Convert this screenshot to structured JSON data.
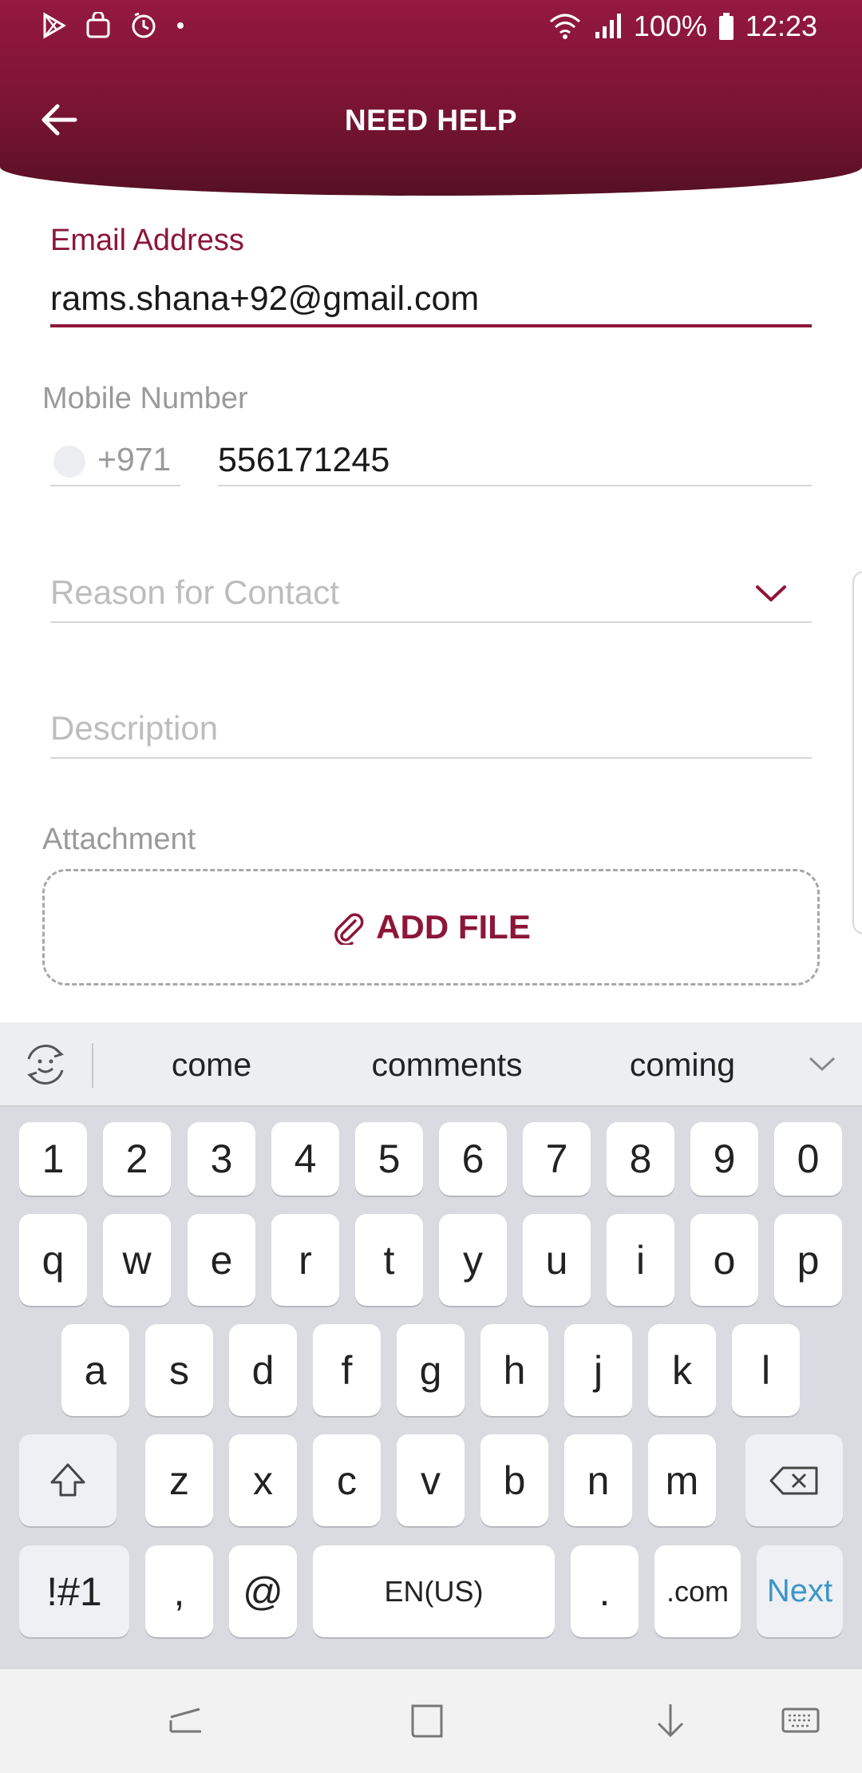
{
  "status_bar": {
    "battery": "100%",
    "time": "12:23",
    "left_icons": [
      "play-store-icon",
      "shopping-bag-icon",
      "clock-icon",
      "dot-icon"
    ],
    "right_icons": [
      "wifi-icon",
      "signal-icon",
      "battery-icon"
    ]
  },
  "header": {
    "title": "NEED HELP",
    "back_icon": "arrow-left-icon",
    "colors": {
      "top": "#951840",
      "bottom": "#561024"
    }
  },
  "form": {
    "email": {
      "label": "Email Address",
      "value": "rams.shana+92@gmail.com"
    },
    "mobile": {
      "label": "Mobile Number",
      "country_code": "+971",
      "value": "556171245"
    },
    "reason": {
      "placeholder": "Reason for Contact"
    },
    "description": {
      "placeholder": "Description"
    },
    "attachment": {
      "label": "Attachment",
      "button_label": "ADD FILE"
    }
  },
  "accent_color": "#8d1638",
  "keyboard": {
    "suggestions": [
      "come",
      "comments",
      "coming"
    ],
    "row_numbers": [
      "1",
      "2",
      "3",
      "4",
      "5",
      "6",
      "7",
      "8",
      "9",
      "0"
    ],
    "row_top": [
      "q",
      "w",
      "e",
      "r",
      "t",
      "y",
      "u",
      "i",
      "o",
      "p"
    ],
    "row_home": [
      "a",
      "s",
      "d",
      "f",
      "g",
      "h",
      "j",
      "k",
      "l"
    ],
    "row_bottom": [
      "z",
      "x",
      "c",
      "v",
      "b",
      "n",
      "m"
    ],
    "symbols_key": "!#1",
    "comma_key": ",",
    "at_key": "@",
    "space_label": "EN(US)",
    "period_key": ".",
    "dotcom_key": ".com",
    "action_key": "Next"
  },
  "nav_bar": {
    "icons": [
      "recents-icon",
      "home-icon",
      "hide-keyboard-icon",
      "keyboard-switch-icon"
    ]
  }
}
